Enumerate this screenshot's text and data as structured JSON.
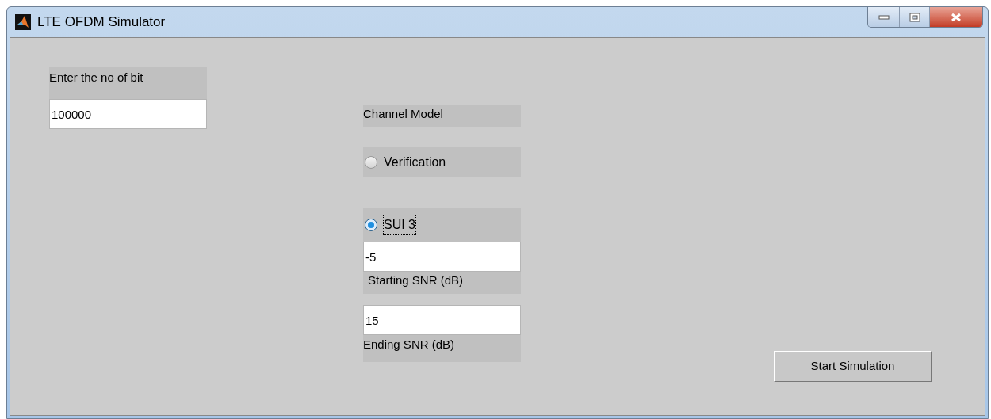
{
  "window": {
    "title": "LTE OFDM Simulator"
  },
  "bits": {
    "label": "Enter the no of bit",
    "value": "100000"
  },
  "channel_model": {
    "label": "Channel Model",
    "options": [
      {
        "label": "Verification",
        "selected": false
      },
      {
        "label": "SUI 3",
        "selected": true
      }
    ]
  },
  "starting_snr": {
    "value": "-5",
    "label": "Starting SNR (dB)"
  },
  "ending_snr": {
    "value": "15",
    "label": "Ending SNR (dB)"
  },
  "start_button": "Start Simulation"
}
